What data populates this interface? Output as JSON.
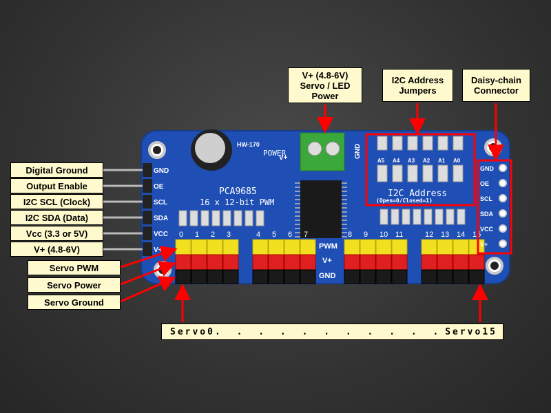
{
  "labels": {
    "power_terminal": [
      "V+ (4.8-6V)",
      "Servo / LED",
      "Power"
    ],
    "i2c_jumpers": [
      "I2C Address",
      "Jumpers"
    ],
    "daisy_chain": [
      "Daisy-chain",
      "Connector"
    ],
    "left_pins": [
      "Digital Ground",
      "Output Enable",
      "I2C SCL (Clock)",
      "I2C SDA (Data)",
      "Vcc (3.3 or 5V)",
      "V+ (4.8-6V)"
    ],
    "servo_rows": [
      "Servo PWM",
      "Servo Power",
      "Servo Ground"
    ],
    "servo_range": {
      "start": "Servo0",
      "dots": ". . . . . . . . . . . . . . . .",
      "end": "Servo15"
    }
  },
  "board": {
    "model": "HW-170",
    "chip": "PCA9685",
    "subtitle": "16 x 12-bit PWM",
    "power_label": "POWER",
    "terminal_plus": "V+",
    "terminal_gnd": "GND",
    "pin_labels": [
      "GND",
      "OE",
      "SCL",
      "SDA",
      "VCC",
      "V+"
    ],
    "address_bits": [
      "A5",
      "A4",
      "A3",
      "A2",
      "A1",
      "A0"
    ],
    "address_title": "I2C Address",
    "address_note": "(Open=0/Closed=1)",
    "row_labels": [
      "PWM",
      "V+",
      "GND"
    ],
    "channels": [
      "0",
      "1",
      "2",
      "3",
      "4",
      "5",
      "6",
      "7",
      "8",
      "9",
      "10",
      "11",
      "12",
      "13",
      "14",
      "15"
    ]
  },
  "colors": {
    "annotation": "#ff0000",
    "label_bg": "#fffacd",
    "pcb": "#1f4fb5",
    "pwm_header": "#f2e020",
    "power_header": "#e02020",
    "ground_header": "#1a1a1a",
    "terminal": "#3aa83a"
  }
}
